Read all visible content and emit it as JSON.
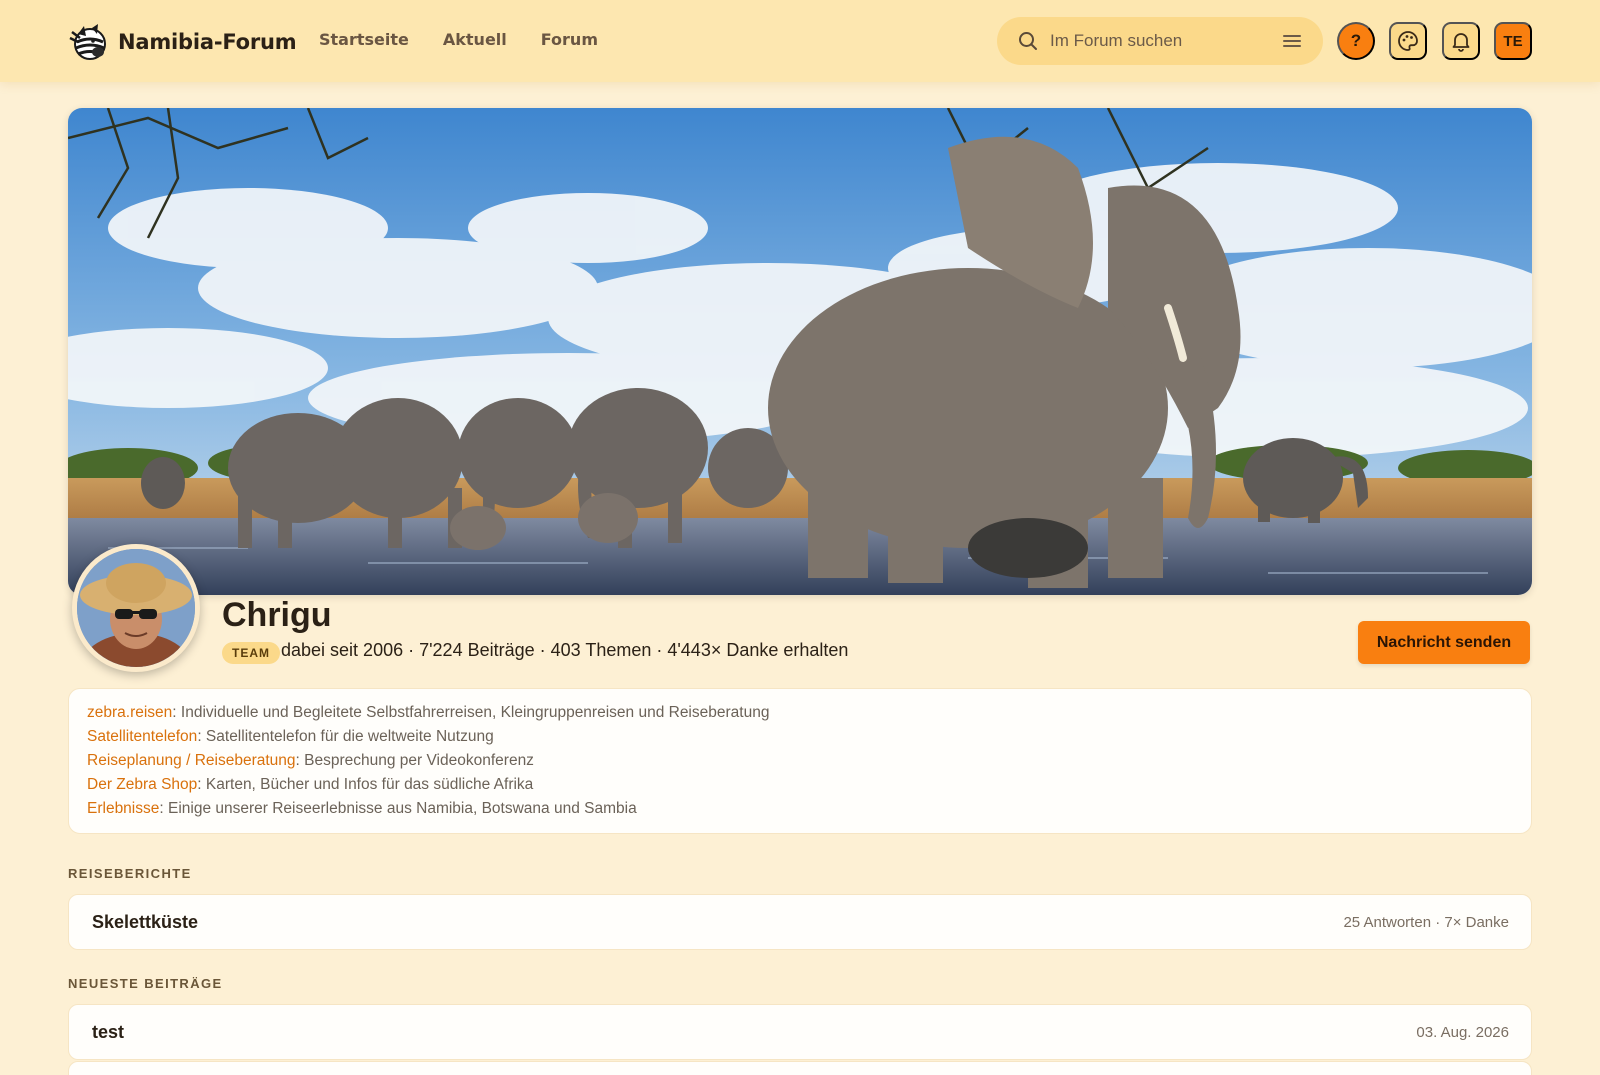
{
  "header": {
    "logo_text": "Namibia-Forum",
    "nav": [
      "Startseite",
      "Aktuell",
      "Forum"
    ],
    "search_placeholder": "Im Forum suchen",
    "help_label": "?",
    "user_initials": "TE",
    "accent_color": "#f97f10"
  },
  "profile": {
    "username": "Chrigu",
    "badge": "TEAM",
    "stats": "dabei seit 2006 · 7'224 Beiträge · 403 Themen · 4'443× Danke erhalten",
    "message_button": "Nachricht senden"
  },
  "info_links": [
    {
      "link": "zebra.reisen",
      "text": ": Individuelle und Begleitete Selbstfahrerreisen, Kleingruppenreisen und Reiseberatung"
    },
    {
      "link": "Satellitentelefon",
      "text": ": Satellitentelefon für die weltweite Nutzung"
    },
    {
      "link": "Reiseplanung / Reiseberatung",
      "text": ": Besprechung per Videokonferenz"
    },
    {
      "link": "Der Zebra Shop",
      "text": ": Karten, Bücher und Infos für das südliche Afrika"
    },
    {
      "link": "Erlebnisse",
      "text": ": Einige unserer Reiseerlebnisse aus Namibia, Botswana und Sambia"
    }
  ],
  "sections": {
    "reiseberichte": {
      "label": "REISEBERICHTE",
      "items": [
        {
          "title": "Skelettküste",
          "meta": "25 Antworten · 7× Danke"
        }
      ]
    },
    "neueste": {
      "label": "NEUESTE BEITRÄGE",
      "items": [
        {
          "title": "test",
          "meta": "03. Aug. 2026"
        }
      ]
    }
  }
}
